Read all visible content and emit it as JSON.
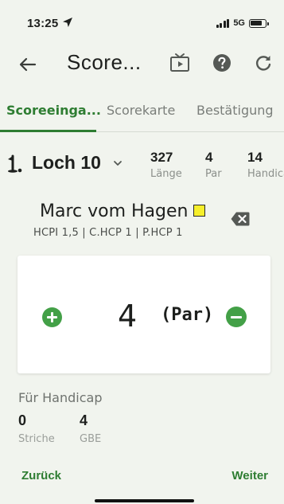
{
  "status_bar": {
    "time": "13:25",
    "network": "5G",
    "location_icon": "location-arrow-icon",
    "battery_level": 0.8
  },
  "app_bar": {
    "title": "Score...",
    "back_icon": "arrow-left-icon",
    "icons": [
      "tv-icon",
      "help-icon",
      "refresh-icon"
    ]
  },
  "tabs": [
    {
      "label": "Scoreeinga...",
      "active": true
    },
    {
      "label": "Scorekarte",
      "active": false
    },
    {
      "label": "Bestätigung",
      "active": false
    }
  ],
  "hole": {
    "label": "Loch 10",
    "icon": "golf-flag-icon",
    "stats": [
      {
        "value": "327",
        "label": "Länge"
      },
      {
        "value": "4",
        "label": "Par"
      },
      {
        "value": "14",
        "label": "Handicap"
      }
    ]
  },
  "player": {
    "name": "Marc vom Hagen",
    "handicap_line": "HCPI 1,5 | C.HCP 1 | P.HCP 1",
    "card_color": "#f6ef2b"
  },
  "score": {
    "value": "4",
    "tag": "(Par)"
  },
  "handicap_section": {
    "label": "Für Handicap",
    "stats": [
      {
        "value": "0",
        "label": "Striche"
      },
      {
        "value": "4",
        "label": "GBE"
      }
    ]
  },
  "footer": {
    "back_label": "Zurück",
    "next_label": "Weiter"
  },
  "colors": {
    "accent": "#2e7d32",
    "button": "#43a047",
    "background": "#f1f4ee"
  }
}
